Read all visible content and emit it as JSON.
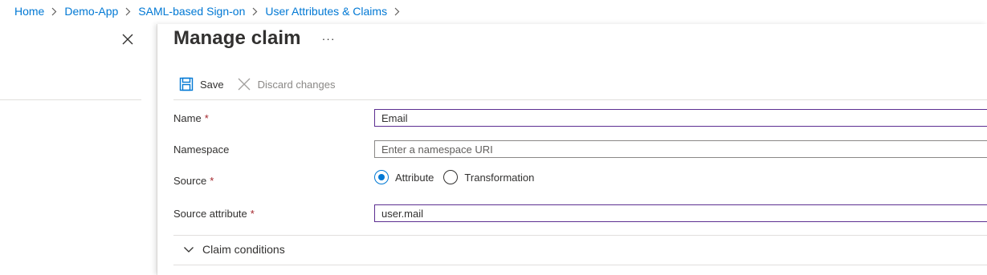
{
  "breadcrumb": {
    "items": [
      "Home",
      "Demo-App",
      "SAML-based Sign-on",
      "User Attributes & Claims"
    ]
  },
  "blade": {
    "title": "Manage claim",
    "more": "···"
  },
  "toolbar": {
    "save_label": "Save",
    "discard_label": "Discard changes"
  },
  "form": {
    "name_label": "Name",
    "name_value": "Email",
    "namespace_label": "Namespace",
    "namespace_value": "",
    "namespace_placeholder": "Enter a namespace URI",
    "source_label": "Source",
    "source_options": [
      "Attribute",
      "Transformation"
    ],
    "source_selected": "Attribute",
    "source_attribute_label": "Source attribute",
    "source_attribute_value": "user.mail",
    "required_marker": "*"
  },
  "claim_conditions": {
    "label": "Claim conditions"
  },
  "colors": {
    "link": "#0078d4",
    "focus_border": "#5c2e91",
    "required": "#a4262c",
    "radio_checked": "#0078d4"
  }
}
